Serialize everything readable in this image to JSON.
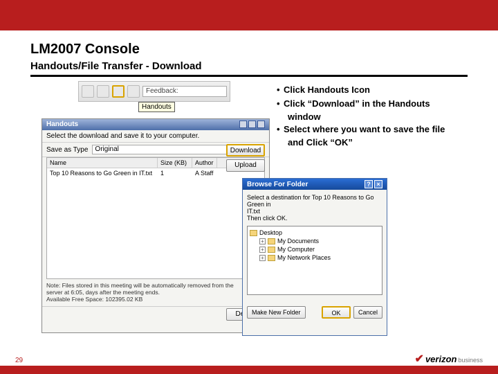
{
  "header": {
    "title": "LM2007 Console",
    "subtitle": "Handouts/File Transfer - Download"
  },
  "toolbar": {
    "feedback_label": "Feedback:",
    "tooltip": "Handouts"
  },
  "handouts_window": {
    "title": "Handouts",
    "prompt": "Select the download and save it to your computer.",
    "save_as_label": "Save as Type",
    "save_as_value": "Original",
    "btn_download": "Download",
    "btn_upload": "Upload",
    "columns": {
      "name": "Name",
      "size": "Size (KB)",
      "author": "Author"
    },
    "row": {
      "name": "Top 10 Reasons to Go Green in IT.txt",
      "size": "1",
      "author": "A Staff"
    },
    "note1": "Note: Files stored in this meeting will be automatically removed from the",
    "note2": "server at 6:05, days after the meeting ends.",
    "note3": "Available Free Space: 102395.02 KB",
    "btn_delete": "Delete"
  },
  "browse_window": {
    "title": "Browse For Folder",
    "prompt1": "Select a destination for Top 10 Reasons to Go Green in",
    "prompt2": "IT.txt",
    "prompt3": "Then click OK.",
    "tree": {
      "desktop": "Desktop",
      "documents": "My Documents",
      "computer": "My Computer",
      "network": "My Network Places"
    },
    "btn_new_folder": "Make New Folder",
    "btn_ok": "OK",
    "btn_cancel": "Cancel"
  },
  "instructions": {
    "b1": "Click Handouts Icon",
    "b2": "Click “Download” in the Handouts",
    "b2b": "window",
    "b3": "Select where you want to save the file",
    "b3b": "and Click “OK”"
  },
  "footer": {
    "page": "29",
    "logo_brand": "verizon",
    "logo_sub": "business"
  }
}
